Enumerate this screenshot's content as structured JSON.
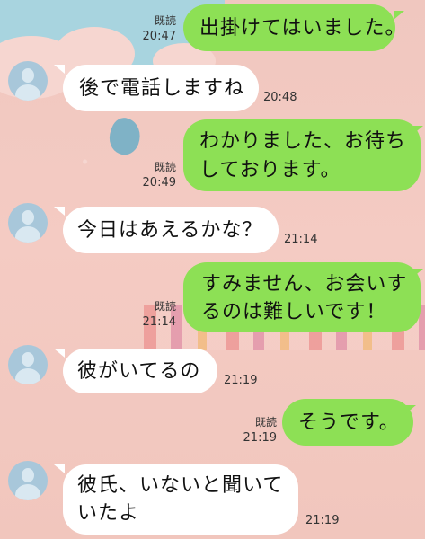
{
  "messages": [
    {
      "side": "sent",
      "lines": [
        "出掛けてはいました。"
      ],
      "read": "既読",
      "time": "20:47"
    },
    {
      "side": "recv",
      "lines": [
        "後で電話しますね"
      ],
      "time": "20:48"
    },
    {
      "side": "sent",
      "lines": [
        "わかりました、お待ち",
        "しております。"
      ],
      "read": "既読",
      "time": "20:49"
    },
    {
      "side": "recv",
      "lines": [
        "今日はあえるかな？"
      ],
      "time": "21:14"
    },
    {
      "side": "sent",
      "lines": [
        "すみません、お会いす",
        "るのは難しいです！"
      ],
      "read": "既読",
      "time": "21:14"
    },
    {
      "side": "recv",
      "lines": [
        "彼がいてるの"
      ],
      "time": "21:19"
    },
    {
      "side": "sent",
      "lines": [
        "そうです。"
      ],
      "read": "既読",
      "time": "21:19"
    },
    {
      "side": "recv",
      "lines": [
        "彼氏、いないと聞いて",
        "いたよ"
      ],
      "time": "21:19"
    }
  ],
  "colors": {
    "sent_bubble": "#8de055",
    "recv_bubble": "#ffffff",
    "avatar": "#a8c7da"
  },
  "icons": {
    "avatar": "default-user-avatar-icon"
  }
}
